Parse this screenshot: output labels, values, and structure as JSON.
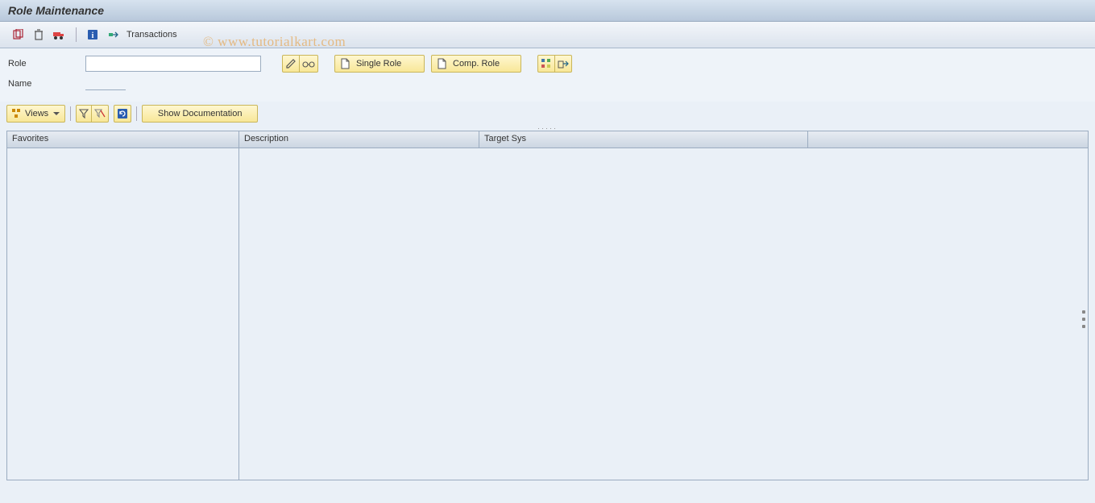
{
  "title": "Role Maintenance",
  "watermark": "© www.tutorialkart.com",
  "toolbar": {
    "transactions_label": "Transactions"
  },
  "form": {
    "role_label": "Role",
    "role_value": "",
    "name_label": "Name",
    "name_value": "",
    "single_role_label": "Single Role",
    "comp_role_label": "Comp. Role"
  },
  "viewsbar": {
    "views_label": "Views",
    "show_doc_label": "Show Documentation"
  },
  "table": {
    "headers": {
      "favorites": "Favorites",
      "description": "Description",
      "target_sys": "Target Sys"
    }
  }
}
